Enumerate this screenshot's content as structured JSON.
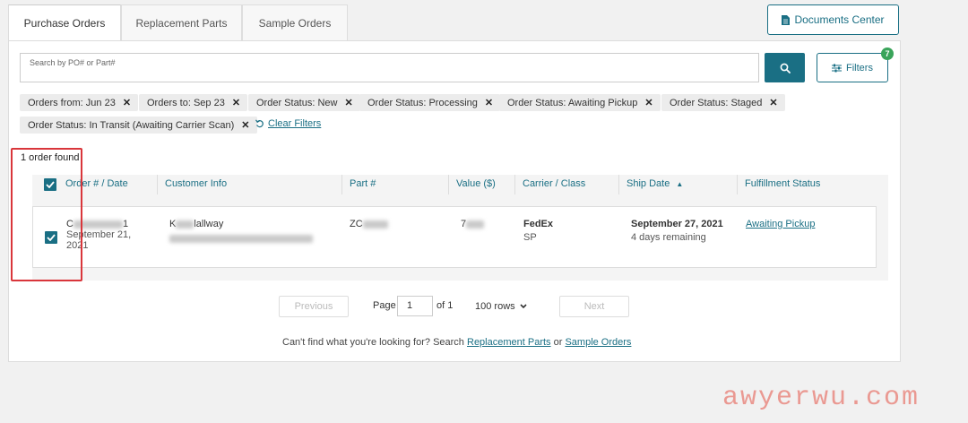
{
  "tabs": [
    {
      "label": "Purchase Orders",
      "active": true
    },
    {
      "label": "Replacement Parts",
      "active": false
    },
    {
      "label": "Sample Orders",
      "active": false
    }
  ],
  "header": {
    "documents_label": "Documents Center"
  },
  "search": {
    "placeholder": "Search by PO# or Part#",
    "button_icon": "search-icon"
  },
  "filters": {
    "label": "Filters",
    "count": "7"
  },
  "chips": [
    "Orders from: Jun 23",
    "Orders to: Sep 23",
    "Order Status: New",
    "Order Status: Processing",
    "Order Status: Awaiting Pickup",
    "Order Status: Staged",
    "Order Status: In Transit (Awaiting Carrier Scan)"
  ],
  "clear_filters_label": "Clear Filters",
  "results": {
    "found_text": "1 order found"
  },
  "table": {
    "columns": [
      "Order # / Date",
      "Customer Info",
      "Part #",
      "Value ($)",
      "Carrier / Class",
      "Ship Date",
      "Fulfillment Status"
    ],
    "sort_indicator": "▲",
    "rows": [
      {
        "order_prefix": "C",
        "order_suffix": "1",
        "order_date_line1": "September 21,",
        "order_date_line2": "2021",
        "customer_name_prefix": "K",
        "customer_name_suffix": "lallway",
        "part_prefix": "ZC",
        "value_prefix": "7",
        "carrier": "FedEx",
        "carrier_class": "SP",
        "ship_date": "September 27, 2021",
        "ship_remaining": "4 days remaining",
        "status": "Awaiting Pickup"
      }
    ]
  },
  "pagination": {
    "previous_label": "Previous",
    "page_label": "Page",
    "page_value": "1",
    "of_label": "of 1",
    "rows_label": "100 rows",
    "next_label": "Next"
  },
  "footer": {
    "text": "Can't find what you're looking for?  Search",
    "link1": "Replacement Parts",
    "or_text": "or",
    "link2": "Sample Orders"
  },
  "watermark": "awyerwu.com",
  "colors": {
    "accent": "#1a6f84",
    "badge": "#3aa45a",
    "highlight": "#d9363b"
  }
}
